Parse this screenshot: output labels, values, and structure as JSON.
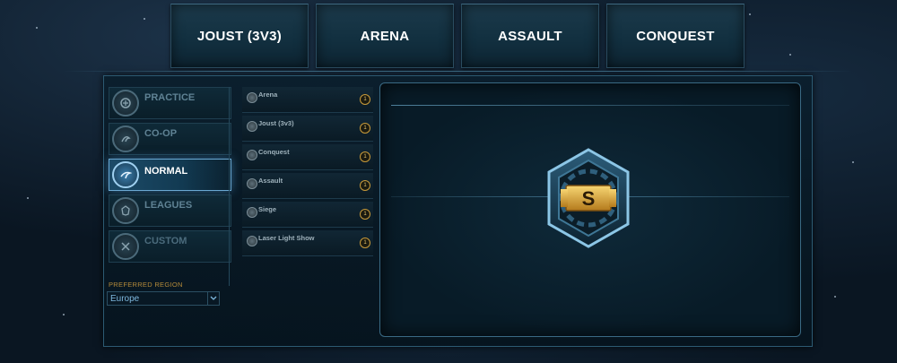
{
  "top_tabs": [
    {
      "label": "JOUST (3V3)"
    },
    {
      "label": "ARENA"
    },
    {
      "label": "ASSAULT"
    },
    {
      "label": "CONQUEST"
    }
  ],
  "modes": [
    {
      "label": "PRACTICE",
      "icon": "practice-icon",
      "active": false
    },
    {
      "label": "CO-OP",
      "icon": "coop-icon",
      "active": false
    },
    {
      "label": "NORMAL",
      "icon": "normal-icon",
      "active": true
    },
    {
      "label": "LEAGUES",
      "icon": "leagues-icon",
      "active": false
    },
    {
      "label": "CUSTOM",
      "icon": "custom-icon",
      "active": false
    }
  ],
  "region": {
    "label": "PREFERRED REGION",
    "value": "Europe"
  },
  "queues": [
    {
      "name": "Arena",
      "badge": "1"
    },
    {
      "name": "Joust (3v3)",
      "badge": "1"
    },
    {
      "name": "Conquest",
      "badge": "1"
    },
    {
      "name": "Assault",
      "badge": "1"
    },
    {
      "name": "Siege",
      "badge": "1"
    },
    {
      "name": "Laser Light Show",
      "badge": "1"
    }
  ],
  "preview": {
    "emblem_letter": "S",
    "emblem_icon": "smite-emblem-icon"
  },
  "colors": {
    "accent": "#6aa8d2",
    "gold": "#e0b24a",
    "region_label": "#b48a3a"
  }
}
